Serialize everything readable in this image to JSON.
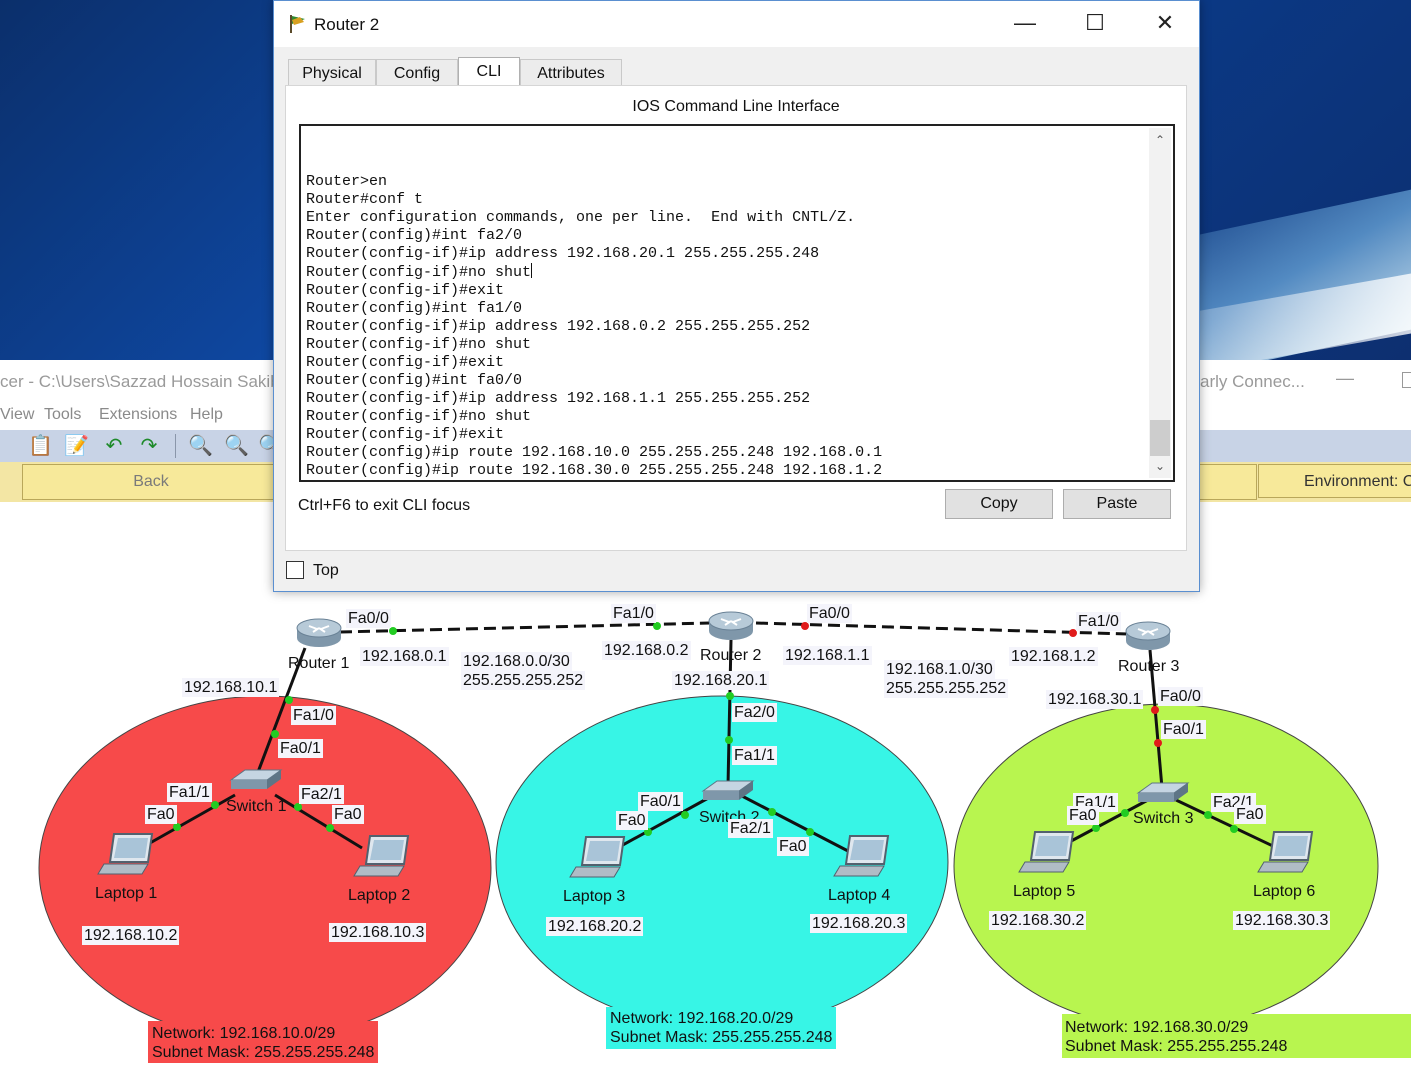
{
  "app": {
    "title": "cer - C:\\Users\\Sazzad Hossain Sakib",
    "title_right": "arly Connec...",
    "menu": [
      "View",
      "Tools",
      "Extensions",
      "Help"
    ],
    "back_label": "Back",
    "environment_label": "Environment: C"
  },
  "dialog": {
    "title": "Router 2",
    "tabs": [
      "Physical",
      "Config",
      "CLI",
      "Attributes"
    ],
    "active_tab": "CLI",
    "heading": "IOS Command Line Interface",
    "cli_lines": [
      "Router>en",
      "Router#conf t",
      "Enter configuration commands, one per line.  End with CNTL/Z.",
      "Router(config)#int fa2/0",
      "Router(config-if)#ip address 192.168.20.1 255.255.255.248",
      "Router(config-if)#no shut",
      "Router(config-if)#exit",
      "Router(config)#int fa1/0",
      "Router(config-if)#ip address 192.168.0.2 255.255.255.252",
      "Router(config-if)#no shut",
      "Router(config-if)#exit",
      "Router(config)#int fa0/0",
      "Router(config-if)#ip address 192.168.1.1 255.255.255.252",
      "Router(config-if)#no shut",
      "Router(config-if)#exit",
      "Router(config)#ip route 192.168.10.0 255.255.255.248 192.168.0.1",
      "Router(config)#ip route 192.168.30.0 255.255.255.248 192.168.1.2"
    ],
    "hint": "Ctrl+F6 to exit CLI focus",
    "copy_label": "Copy",
    "paste_label": "Paste",
    "top_label": "Top",
    "top_checked": false
  },
  "topology": {
    "colors": {
      "net1": "#f74a4a",
      "net2": "#37f5e6",
      "net3": "#b8f54f",
      "up": "#22cc22",
      "down": "#e01b1b"
    },
    "routers": [
      "Router 1",
      "Router 2",
      "Router 3"
    ],
    "switches": [
      "Switch 1",
      "Switch 2",
      "Switch 3"
    ],
    "laptops": [
      "Laptop 1",
      "Laptop 2",
      "Laptop 3",
      "Laptop 4",
      "Laptop 5",
      "Laptop 6"
    ],
    "ports": {
      "r1_fa00": "Fa0/0",
      "r2_fa10": "Fa1/0",
      "r2_fa00": "Fa0/0",
      "r3_fa10": "Fa1/0",
      "r1_fa10": "Fa1/0",
      "s1_fa01": "Fa0/1",
      "s1_fa11": "Fa1/1",
      "s1_fa21": "Fa2/1",
      "l1_fa0": "Fa0",
      "l2_fa0": "Fa0",
      "r2_fa20": "Fa2/0",
      "s2_fa11": "Fa1/1",
      "s2_fa01": "Fa0/1",
      "s2_fa21": "Fa2/1",
      "l3_fa0": "Fa0",
      "l4_fa0": "Fa0",
      "r3_fa00": "Fa0/0",
      "s3_fa01": "Fa0/1",
      "s3_fa11": "Fa1/1",
      "s3_fa21": "Fa2/1",
      "l5_fa0": "Fa0",
      "l6_fa0": "Fa0"
    },
    "ips": {
      "r1_wan": "192.168.0.1",
      "r2_wan1": "192.168.0.2",
      "r2_wan2": "192.168.1.1",
      "r3_wan": "192.168.1.2",
      "r1_lan": "192.168.10.1",
      "r2_lan": "192.168.20.1",
      "r3_lan": "192.168.30.1",
      "l1": "192.168.10.2",
      "l2": "192.168.10.3",
      "l3": "192.168.20.2",
      "l4": "192.168.20.3",
      "l5": "192.168.30.2",
      "l6": "192.168.30.3"
    },
    "wan_links": [
      {
        "network": "192.168.0.0/30",
        "mask": "255.255.255.252"
      },
      {
        "network": "192.168.1.0/30",
        "mask": "255.255.255.252"
      }
    ],
    "lans": [
      {
        "network": "Network: 192.168.10.0/29",
        "mask": "Subnet Mask: 255.255.255.248"
      },
      {
        "network": "Network: 192.168.20.0/29",
        "mask": "Subnet Mask: 255.255.255.248"
      },
      {
        "network": "Network: 192.168.30.0/29",
        "mask": "Subnet Mask: 255.255.255.248"
      }
    ]
  }
}
